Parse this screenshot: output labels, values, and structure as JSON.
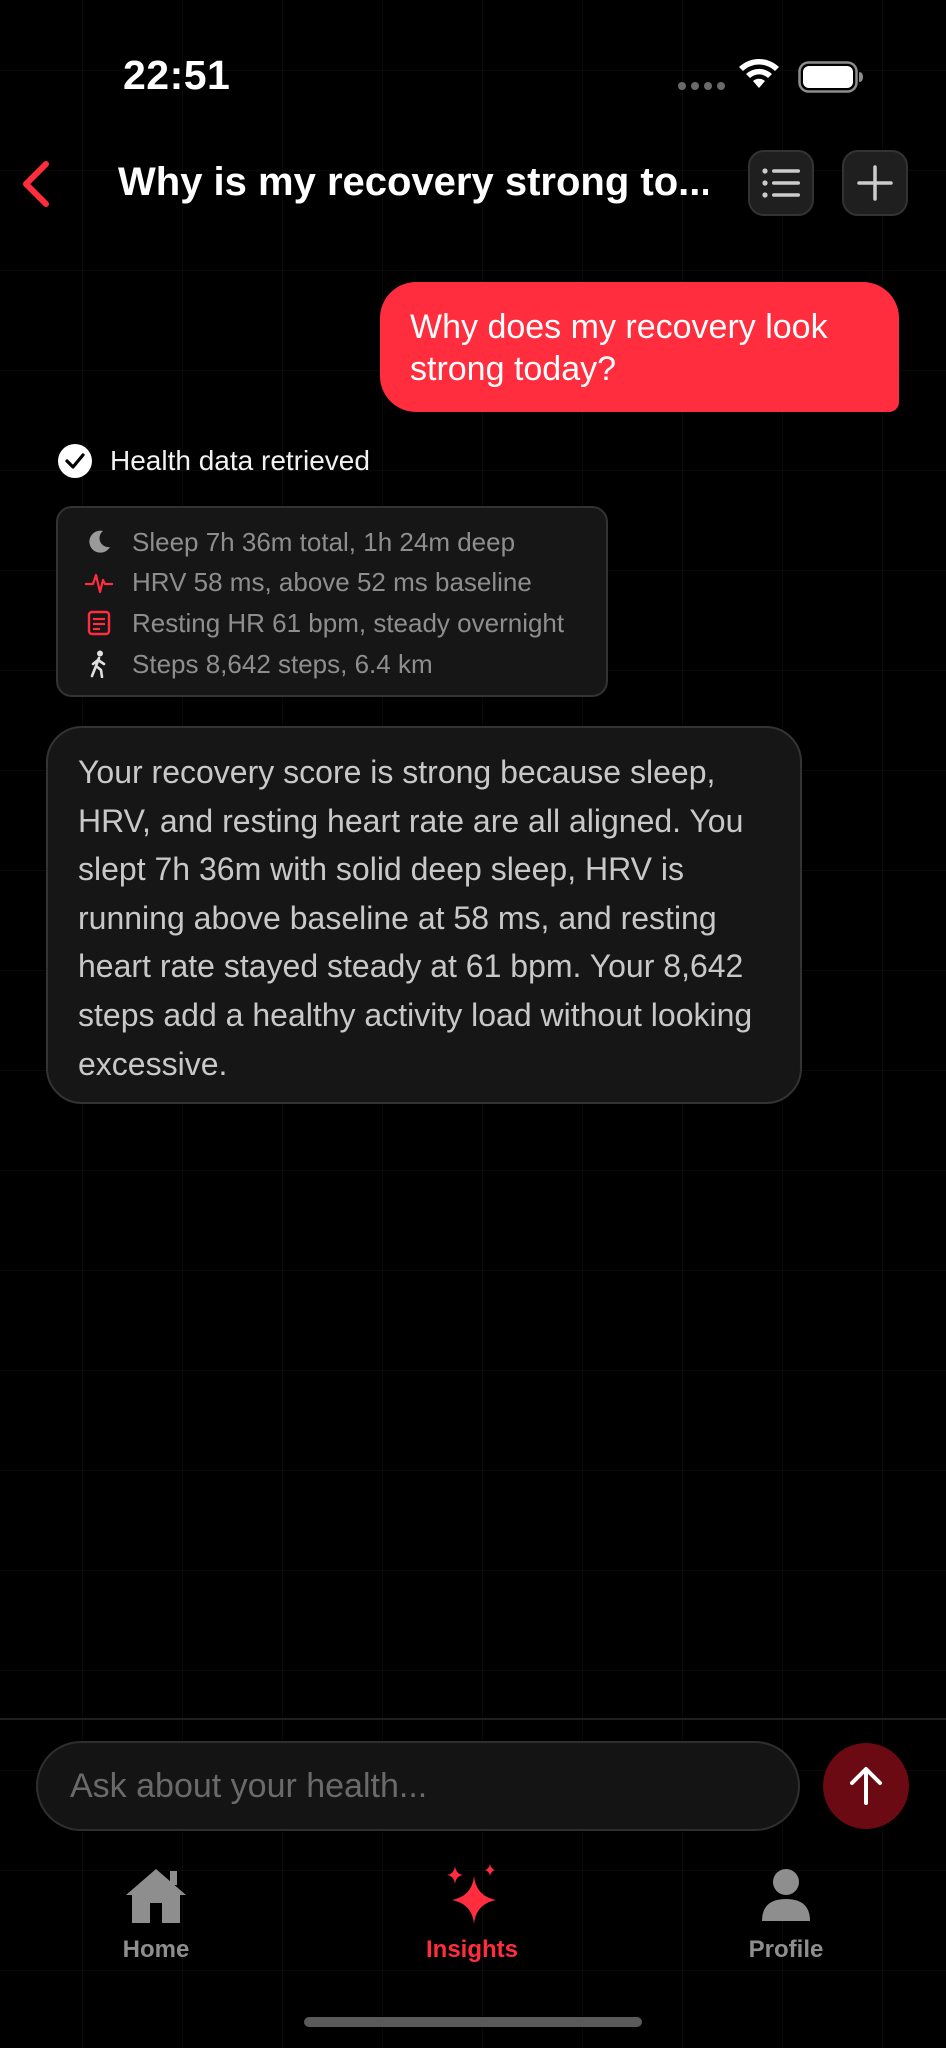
{
  "status_bar": {
    "time": "22:51"
  },
  "header": {
    "title": "Why is my recovery strong to..."
  },
  "conversation": {
    "user_message": "Why does my recovery look strong today?",
    "tool_status": "Health data retrieved",
    "health_items": [
      {
        "icon": "moon-icon",
        "text": "Sleep 7h 36m total, 1h 24m deep"
      },
      {
        "icon": "heartbeat-icon",
        "text": "HRV 58 ms, above 52 ms baseline"
      },
      {
        "icon": "heart-rate-monitor-icon",
        "text": "Resting HR 61 bpm, steady overnight"
      },
      {
        "icon": "walking-icon",
        "text": "Steps 8,642 steps, 6.4 km"
      }
    ],
    "assistant_message": "Your recovery score is strong because sleep, HRV, and resting heart rate are all aligned. You slept 7h 36m with solid deep sleep, HRV is running above baseline at 58 ms, and resting heart rate stayed steady at 61 bpm. Your 8,642 steps add a healthy activity load without looking excessive."
  },
  "composer": {
    "placeholder": "Ask about your health..."
  },
  "tab_bar": {
    "home": "Home",
    "insights": "Insights",
    "profile": "Profile"
  },
  "colors": {
    "accent": "#ff2d3d",
    "send_button": "#6b0a12",
    "background": "#000000",
    "card": "#161616"
  }
}
